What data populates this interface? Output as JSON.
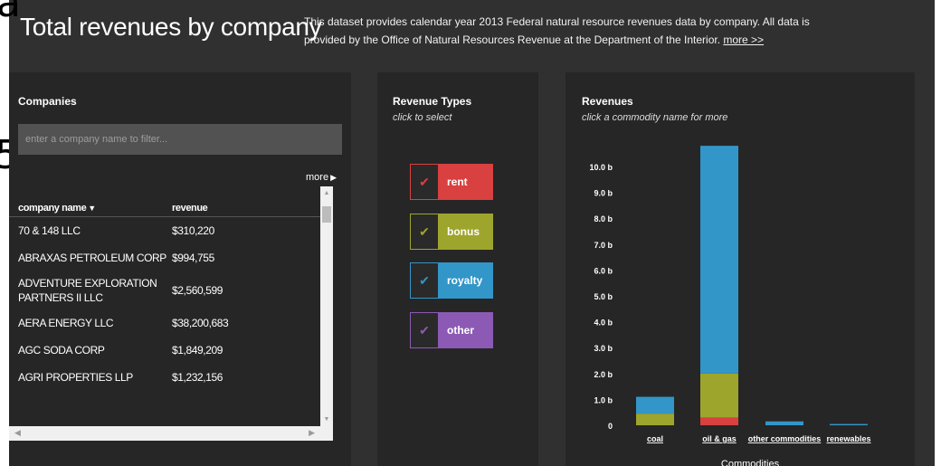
{
  "header": {
    "title": "Total revenues by company",
    "description": "This dataset provides calendar year 2013 Federal natural resource revenues data by company. All data is provided by the Office of Natural Resources Revenue at the Department of the Interior.",
    "more_link": "more >>"
  },
  "edge_glyphs": [
    "a",
    "5"
  ],
  "companies": {
    "title": "Companies",
    "filter_placeholder": "enter a company name to filter...",
    "more_label": "more",
    "more_icon": "triangle-right-icon",
    "sort_icon": "chevron-down-icon",
    "columns": [
      "company name",
      "revenue"
    ],
    "rows": [
      {
        "name": "70 & 148 LLC",
        "revenue": "$310,220"
      },
      {
        "name": "ABRAXAS PETROLEUM CORP",
        "revenue": "$994,755"
      },
      {
        "name": "ADVENTURE EXPLORATION PARTNERS II LLC",
        "revenue": "$2,560,599"
      },
      {
        "name": "AERA ENERGY LLC",
        "revenue": "$38,200,683"
      },
      {
        "name": "AGC SODA CORP",
        "revenue": "$1,849,209"
      },
      {
        "name": "AGRI PROPERTIES LLP",
        "revenue": "$1,232,156"
      }
    ]
  },
  "revenue_types": {
    "title": "Revenue Types",
    "subtitle": "click to select",
    "items": [
      {
        "label": "rent",
        "color": "#d94040",
        "check_icon": "checkmark-icon"
      },
      {
        "label": "bonus",
        "color": "#9ea52c",
        "check_icon": "checkmark-icon"
      },
      {
        "label": "royalty",
        "color": "#3296c8",
        "check_icon": "checkmark-icon"
      },
      {
        "label": "other",
        "color": "#8c5ab4",
        "check_icon": "checkmark-icon"
      }
    ]
  },
  "revenues": {
    "title": "Revenues",
    "subtitle": "click a commodity name for more"
  },
  "chart_data": {
    "type": "bar",
    "stacked": true,
    "categories": [
      "coal",
      "oil & gas",
      "other commodities",
      "renewables"
    ],
    "series": [
      {
        "name": "rent",
        "color": "#d94040",
        "values": [
          0.0,
          0.3,
          0.0,
          0.0
        ]
      },
      {
        "name": "bonus",
        "color": "#9ea52c",
        "values": [
          0.45,
          1.7,
          0.0,
          0.0
        ]
      },
      {
        "name": "royalty",
        "color": "#3296c8",
        "values": [
          0.65,
          8.8,
          0.15,
          0.05
        ]
      },
      {
        "name": "other",
        "color": "#8c5ab4",
        "values": [
          0.0,
          0.0,
          0.0,
          0.0
        ]
      }
    ],
    "y_ticks": [
      "0",
      "1.0 b",
      "2.0 b",
      "3.0 b",
      "4.0 b",
      "5.0 b",
      "6.0 b",
      "7.0 b",
      "8.0 b",
      "9.0 b",
      "10.0 b"
    ],
    "ylim": [
      0,
      10.8
    ],
    "xlabel": "Commodities",
    "ylabel": "",
    "grid": false
  }
}
